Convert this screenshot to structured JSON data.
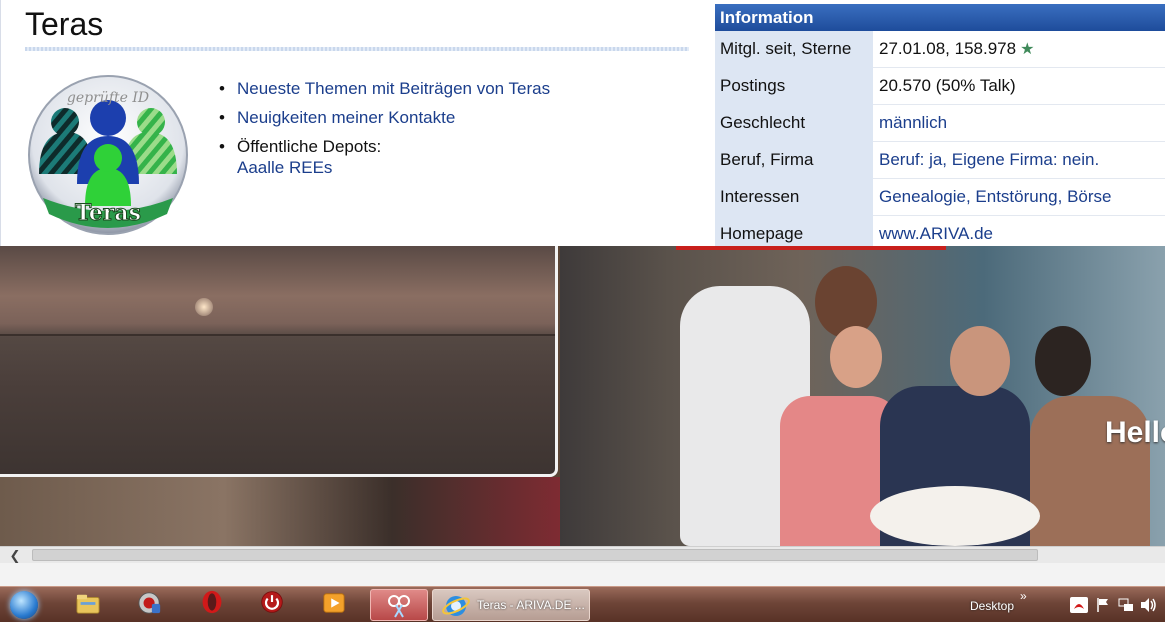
{
  "profile": {
    "title": "Teras",
    "badge": {
      "top_text": "geprüfte ID",
      "bottom_text": "Teras"
    },
    "links": [
      {
        "label": "Neueste Themen mit Beiträgen von Teras"
      },
      {
        "label": "Neuigkeiten meiner Kontakte"
      }
    ],
    "depots": {
      "label": "Öffentliche Depots:",
      "link": "Aaalle REEs"
    }
  },
  "info": {
    "header": "Information",
    "rows": [
      {
        "key": "Mitgl. seit, Sterne",
        "value": "27.01.08, 158.978"
      },
      {
        "key": "Postings",
        "value": "20.570 (50% Talk)"
      },
      {
        "key": "Geschlecht",
        "value": "männlich"
      },
      {
        "key": "Beruf, Firma",
        "value": "Beruf: ja, Eigene Firma: nein."
      },
      {
        "key": "Interessen",
        "value": "Genealogie, Entstörung, Börse"
      },
      {
        "key": "Homepage",
        "value": "www.ARIVA.de"
      }
    ]
  },
  "banner": {
    "text": "Hello"
  },
  "taskbar": {
    "ie_task_label": "Teras - ARIVA.DE ...",
    "desktop_label": "Desktop",
    "desktop_chevron": "»"
  },
  "icons": {
    "star": "star-icon",
    "start": "windows-start-icon",
    "explorer": "folder-icon",
    "ie": "internet-explorer-icon"
  },
  "colors": {
    "link": "#1b3e8c",
    "info_header": "#1e4c9b",
    "info_key_bg": "#dde6f3",
    "star": "#3f8a5a"
  }
}
